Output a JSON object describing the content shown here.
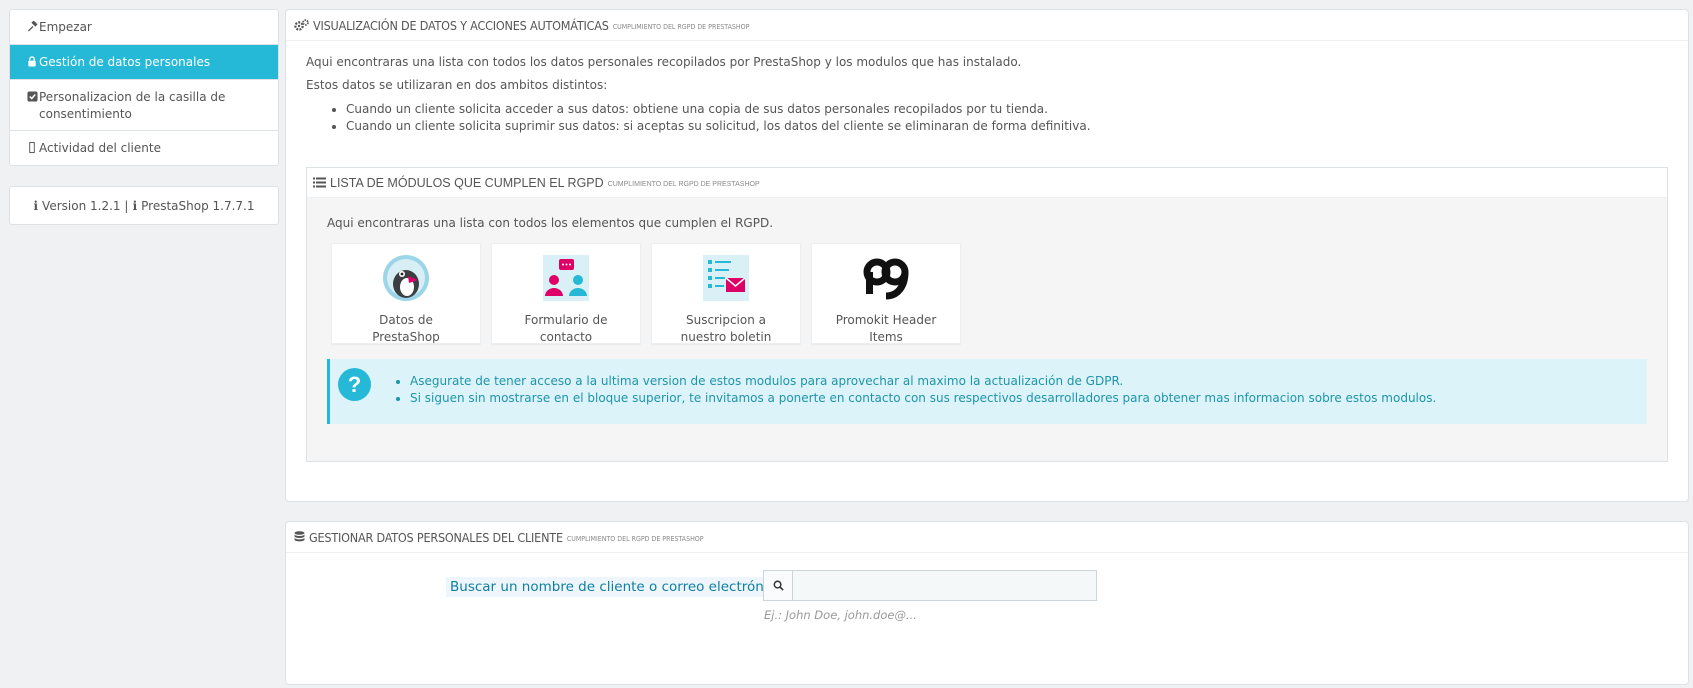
{
  "sidebar": {
    "items": [
      {
        "label": "Empezar",
        "icon": "hammer-icon",
        "active": false
      },
      {
        "label": "Gestión de datos personales",
        "icon": "lock-icon",
        "active": true
      },
      {
        "label": "Personalizacion de la casilla de consentimiento",
        "icon": "checkbox-icon",
        "active": false
      },
      {
        "label": "Actividad del cliente",
        "icon": "clock-icon",
        "active": false
      }
    ],
    "version_text": "Version 1.2.1 | ",
    "prestashop_text": "PrestaShop 1.7.7.1"
  },
  "panel_visualizacion": {
    "title": "VISUALIZACIÓN DE DATOS Y ACCIONES AUTOMÁTICAS",
    "subtitle": "CUMPLIMIENTO DEL RGPD DE PRESTASHOP",
    "intro": "Aqui encontraras una lista con todos los datos personales recopilados por PrestaShop y los modulos que has instalado.",
    "scope_text": "Estos datos se utilizaran en dos ambitos distintos:",
    "bullets": [
      "Cuando un cliente solicita acceder a sus datos: obtiene una copia de sus datos personales recopilados por tu tienda.",
      "Cuando un cliente solicita suprimir sus datos: si aceptas su solicitud, los datos del cliente se eliminaran de forma definitiva."
    ]
  },
  "panel_modulos": {
    "title": "LISTA DE MÓDULOS QUE CUMPLEN EL RGPD",
    "subtitle": "CUMPLIMIENTO DEL RGPD DE PRESTASHOP",
    "intro": "Aqui encontraras una lista con todos los elementos que cumplen el RGPD.",
    "modules": [
      {
        "name": "Datos de PrestaShop",
        "icon": "prestashop-puffin-icon"
      },
      {
        "name": "Formulario de contacto",
        "icon": "contact-form-icon"
      },
      {
        "name": "Suscripcion a nuestro boletin de noticias",
        "icon": "newsletter-icon"
      },
      {
        "name": "Promokit Header Items",
        "icon": "promokit-icon"
      }
    ],
    "alert_items": [
      "Asegurate de tener acceso a la ultima version de estos modulos para aprovechar al maximo la actualización de GDPR.",
      "Si siguen sin mostrarse en el bloque superior, te invitamos a ponerte en contacto con sus respectivos desarrolladores para obtener mas informacion sobre estos modulos."
    ]
  },
  "panel_gestionar": {
    "title": "GESTIONAR DATOS PERSONALES DEL CLIENTE",
    "subtitle": "CUMPLIMIENTO DEL RGPD DE PRESTASHOP",
    "search_label": "Buscar un nombre de cliente o correo electrónico",
    "search_value": "",
    "search_placeholder": "",
    "help_text": "Ej.: John Doe, john.doe@..."
  },
  "colors": {
    "accent": "#25b9d7",
    "alert_bg": "#dcf4f9",
    "alert_text": "#1e94ab"
  }
}
